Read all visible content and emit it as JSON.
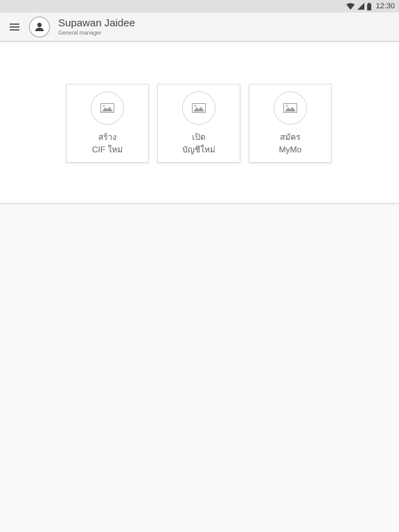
{
  "status_bar": {
    "time": "12:30",
    "icons": [
      "wifi-icon",
      "cell-signal-icon",
      "battery-icon"
    ]
  },
  "app_bar": {
    "menu_icon": "hamburger-menu-icon",
    "avatar_icon": "account-circle-icon",
    "user_name": "Supawan Jaidee",
    "user_role": "General manager"
  },
  "cards": [
    {
      "icon": "image-placeholder-icon",
      "line1": "สร้าง",
      "line2": "CIF ใหม่"
    },
    {
      "icon": "image-placeholder-icon",
      "line1": "เปิด",
      "line2": "บัญชีใหม่"
    },
    {
      "icon": "image-placeholder-icon",
      "line1": "สมัคร",
      "line2": "MyMo"
    }
  ],
  "colors": {
    "status_bar": "#e0e0e0",
    "app_bar": "#f5f5f5",
    "panel": "#ffffff",
    "background": "#fafafa",
    "text": "#424242"
  }
}
